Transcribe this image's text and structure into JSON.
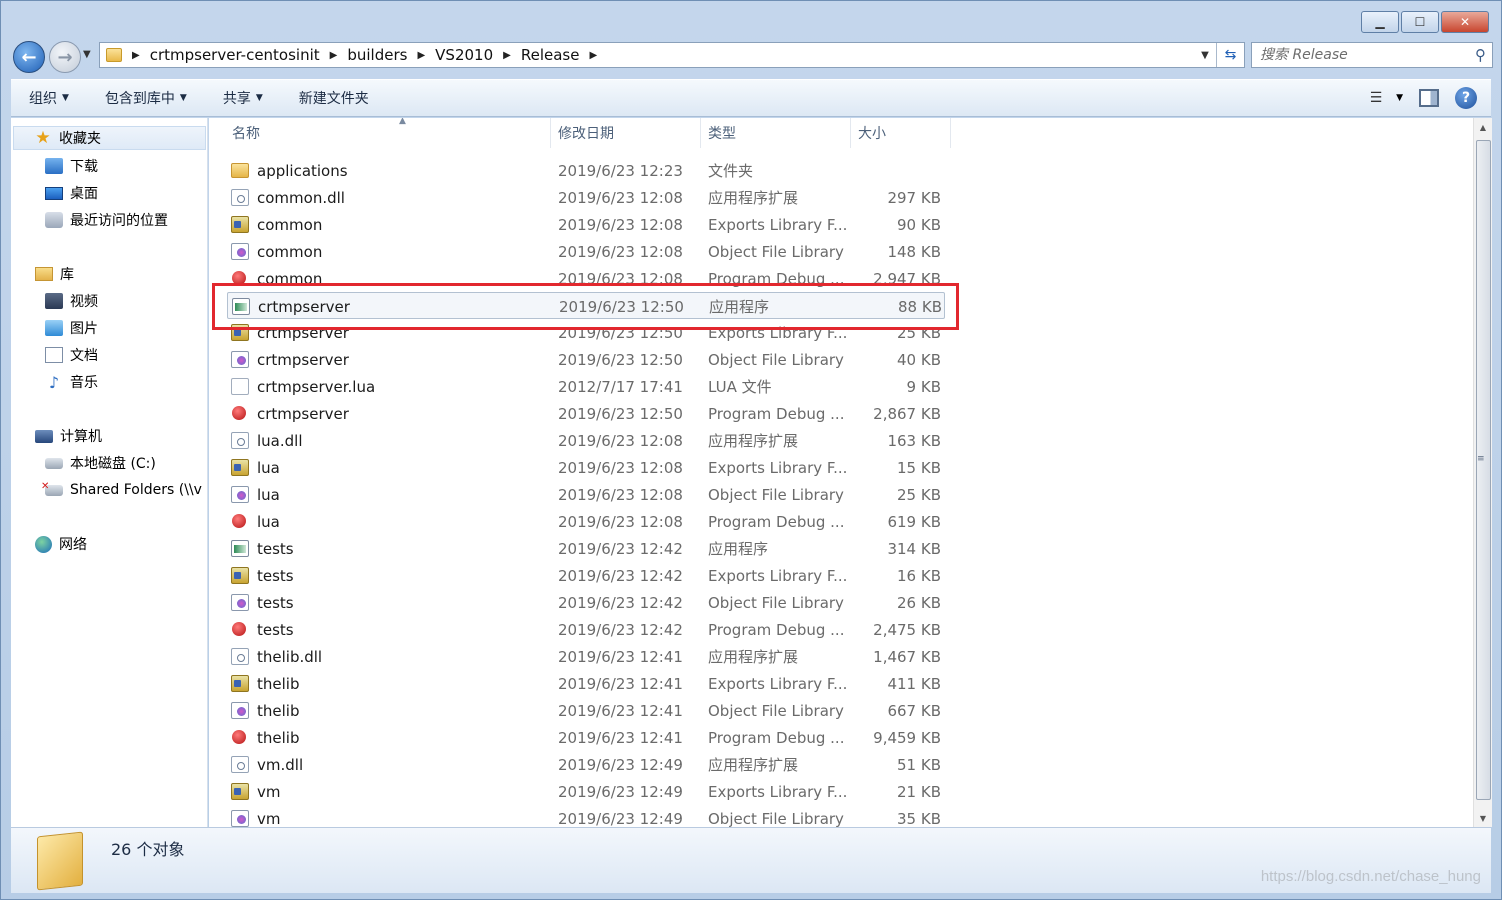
{
  "window": {
    "minimize": "▁",
    "maximize": "☐",
    "close": "✕"
  },
  "navigation": {
    "breadcrumbs": [
      "crtmpserver-centosinit",
      "builders",
      "VS2010",
      "Release"
    ],
    "search_placeholder": "搜索 Release"
  },
  "toolbar": {
    "organize": "组织",
    "include_library": "包含到库中",
    "share": "共享",
    "new_folder": "新建文件夹"
  },
  "sidebar": {
    "favorites": "收藏夹",
    "downloads": "下载",
    "desktop": "桌面",
    "recent": "最近访问的位置",
    "libraries": "库",
    "videos": "视频",
    "pictures": "图片",
    "documents": "文档",
    "music": "音乐",
    "computer": "计算机",
    "local_disk": "本地磁盘 (C:)",
    "shared_folders": "Shared Folders (\\\\v",
    "network": "网络"
  },
  "columns": {
    "name": "名称",
    "date": "修改日期",
    "type": "类型",
    "size": "大小"
  },
  "files": [
    {
      "name": "applications",
      "date": "2019/6/23 12:23",
      "type": "文件夹",
      "size": "",
      "icon": "folder-icon"
    },
    {
      "name": "common.dll",
      "date": "2019/6/23 12:08",
      "type": "应用程序扩展",
      "size": "297 KB",
      "icon": "dll-icon"
    },
    {
      "name": "common",
      "date": "2019/6/23 12:08",
      "type": "Exports Library F...",
      "size": "90 KB",
      "icon": "exports-library-icon"
    },
    {
      "name": "common",
      "date": "2019/6/23 12:08",
      "type": "Object File Library",
      "size": "148 KB",
      "icon": "object-library-icon"
    },
    {
      "name": "common",
      "date": "2019/6/23 12:08",
      "type": "Program Debug ...",
      "size": "2,947 KB",
      "icon": "debug-database-icon"
    },
    {
      "name": "crtmpserver",
      "date": "2019/6/23 12:50",
      "type": "应用程序",
      "size": "88 KB",
      "icon": "application-icon",
      "selected": true
    },
    {
      "name": "crtmpserver",
      "date": "2019/6/23 12:50",
      "type": "Exports Library F...",
      "size": "25 KB",
      "icon": "exports-library-icon"
    },
    {
      "name": "crtmpserver",
      "date": "2019/6/23 12:50",
      "type": "Object File Library",
      "size": "40 KB",
      "icon": "object-library-icon"
    },
    {
      "name": "crtmpserver.lua",
      "date": "2012/7/17 17:41",
      "type": "LUA 文件",
      "size": "9 KB",
      "icon": "lua-file-icon"
    },
    {
      "name": "crtmpserver",
      "date": "2019/6/23 12:50",
      "type": "Program Debug ...",
      "size": "2,867 KB",
      "icon": "debug-database-icon"
    },
    {
      "name": "lua.dll",
      "date": "2019/6/23 12:08",
      "type": "应用程序扩展",
      "size": "163 KB",
      "icon": "dll-icon"
    },
    {
      "name": "lua",
      "date": "2019/6/23 12:08",
      "type": "Exports Library F...",
      "size": "15 KB",
      "icon": "exports-library-icon"
    },
    {
      "name": "lua",
      "date": "2019/6/23 12:08",
      "type": "Object File Library",
      "size": "25 KB",
      "icon": "object-library-icon"
    },
    {
      "name": "lua",
      "date": "2019/6/23 12:08",
      "type": "Program Debug ...",
      "size": "619 KB",
      "icon": "debug-database-icon"
    },
    {
      "name": "tests",
      "date": "2019/6/23 12:42",
      "type": "应用程序",
      "size": "314 KB",
      "icon": "application-icon"
    },
    {
      "name": "tests",
      "date": "2019/6/23 12:42",
      "type": "Exports Library F...",
      "size": "16 KB",
      "icon": "exports-library-icon"
    },
    {
      "name": "tests",
      "date": "2019/6/23 12:42",
      "type": "Object File Library",
      "size": "26 KB",
      "icon": "object-library-icon"
    },
    {
      "name": "tests",
      "date": "2019/6/23 12:42",
      "type": "Program Debug ...",
      "size": "2,475 KB",
      "icon": "debug-database-icon"
    },
    {
      "name": "thelib.dll",
      "date": "2019/6/23 12:41",
      "type": "应用程序扩展",
      "size": "1,467 KB",
      "icon": "dll-icon"
    },
    {
      "name": "thelib",
      "date": "2019/6/23 12:41",
      "type": "Exports Library F...",
      "size": "411 KB",
      "icon": "exports-library-icon"
    },
    {
      "name": "thelib",
      "date": "2019/6/23 12:41",
      "type": "Object File Library",
      "size": "667 KB",
      "icon": "object-library-icon"
    },
    {
      "name": "thelib",
      "date": "2019/6/23 12:41",
      "type": "Program Debug ...",
      "size": "9,459 KB",
      "icon": "debug-database-icon"
    },
    {
      "name": "vm.dll",
      "date": "2019/6/23 12:49",
      "type": "应用程序扩展",
      "size": "51 KB",
      "icon": "dll-icon"
    },
    {
      "name": "vm",
      "date": "2019/6/23 12:49",
      "type": "Exports Library F...",
      "size": "21 KB",
      "icon": "exports-library-icon"
    },
    {
      "name": "vm",
      "date": "2019/6/23 12:49",
      "type": "Object File Library",
      "size": "35 KB",
      "icon": "object-library-icon"
    }
  ],
  "status": {
    "object_count": "26 个对象"
  },
  "watermark": "https://blog.csdn.net/chase_hung",
  "colors": {
    "highlight": "#e2282e",
    "accent": "#1f5fb5"
  }
}
